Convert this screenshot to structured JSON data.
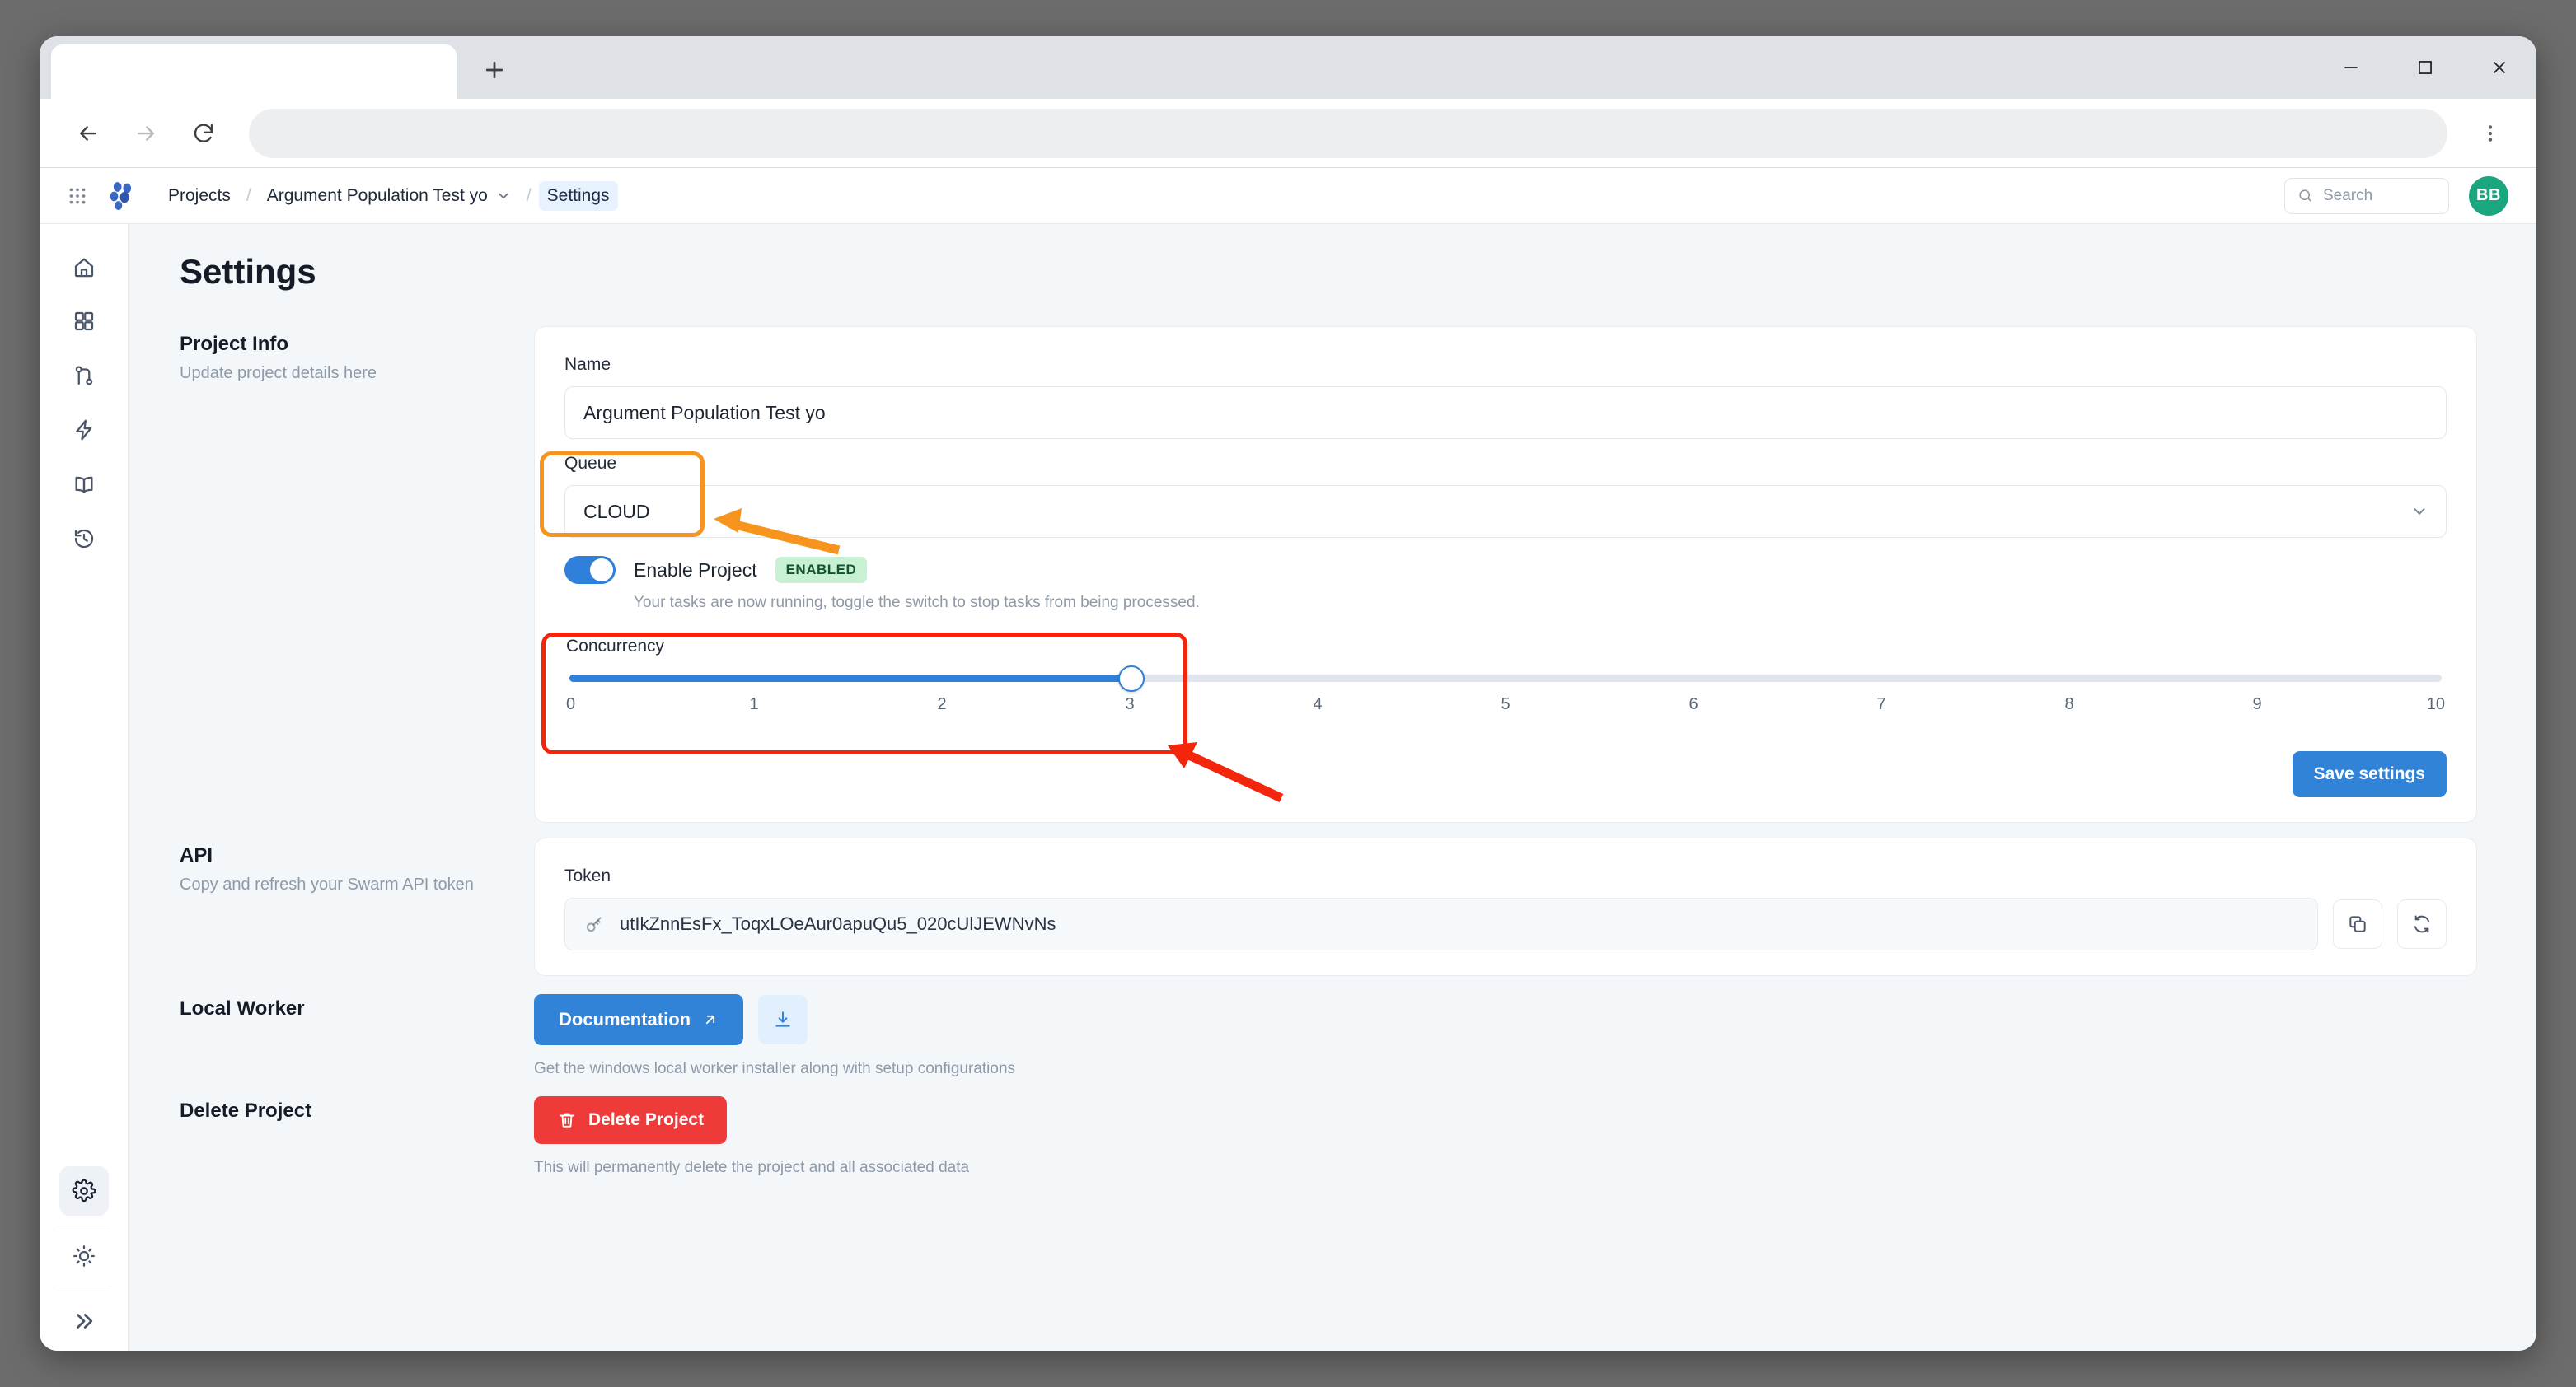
{
  "browser": {
    "tab_title": "",
    "url": "",
    "newtab_label": "New tab",
    "back_label": "Back",
    "forward_label": "Forward",
    "reload_label": "Reload",
    "menu_label": "Customize and control",
    "minimize_label": "Minimize",
    "maximize_label": "Maximize",
    "close_label": "Close"
  },
  "header": {
    "breadcrumb": [
      {
        "label": "Projects",
        "active": false,
        "has_chevron": false
      },
      {
        "label": "Argument Population Test yo",
        "active": false,
        "has_chevron": true
      },
      {
        "label": "Settings",
        "active": true,
        "has_chevron": false
      }
    ],
    "separator": "/",
    "search": {
      "value": "",
      "placeholder": "Search"
    },
    "avatar_initials": "BB"
  },
  "sidebar": {
    "top_items": [
      {
        "name": "home",
        "active": false
      },
      {
        "name": "dashboard",
        "active": false
      },
      {
        "name": "workflows",
        "active": false
      },
      {
        "name": "activity",
        "active": false
      },
      {
        "name": "docs",
        "active": false
      },
      {
        "name": "history",
        "active": false
      }
    ],
    "bottom_items": [
      {
        "name": "settings",
        "active": true
      },
      {
        "name": "theme",
        "active": false
      },
      {
        "name": "expand",
        "active": false
      }
    ]
  },
  "page": {
    "title": "Settings"
  },
  "project_info": {
    "heading": "Project Info",
    "subtext": "Update project details here",
    "name_label": "Name",
    "name_value": "Argument Population Test yo",
    "queue_label": "Queue",
    "queue_value": "CLOUD",
    "queue_options": [
      "CLOUD"
    ],
    "enable_label": "Enable Project",
    "enable_badge": "ENABLED",
    "enable_on": true,
    "enable_help": "Your tasks are now running, toggle the switch to stop tasks from being processed.",
    "concurrency_label": "Concurrency",
    "concurrency_value": 3,
    "concurrency_min": 0,
    "concurrency_max": 10,
    "concurrency_ticks": [
      "0",
      "1",
      "2",
      "3",
      "4",
      "5",
      "6",
      "7",
      "8",
      "9",
      "10"
    ],
    "save_label": "Save settings"
  },
  "api": {
    "heading": "API",
    "subtext": "Copy and refresh your Swarm API token",
    "token_label": "Token",
    "token_value": "utIkZnnEsFx_ToqxLOeAur0apuQu5_020cUlJEWNvNs",
    "copy_label": "Copy token",
    "refresh_label": "Refresh token"
  },
  "local_worker": {
    "heading": "Local Worker",
    "doc_label": "Documentation",
    "download_label": "Download installer",
    "help": "Get the windows local worker installer along with setup configurations"
  },
  "delete_project": {
    "heading": "Delete Project",
    "button_label": "Delete Project",
    "help": "This will permanently delete the project and all associated data"
  },
  "annotations": {
    "queue_highlight_color": "#f7941d",
    "concurrency_highlight_color": "#f4250d"
  },
  "colors": {
    "accent_blue": "#3183d8",
    "danger_red": "#ef3a3a",
    "badge_green_bg": "#c8f0d2",
    "badge_green_text": "#14532d",
    "avatar_green": "#1aa67f",
    "page_bg": "#f4f7fa"
  }
}
